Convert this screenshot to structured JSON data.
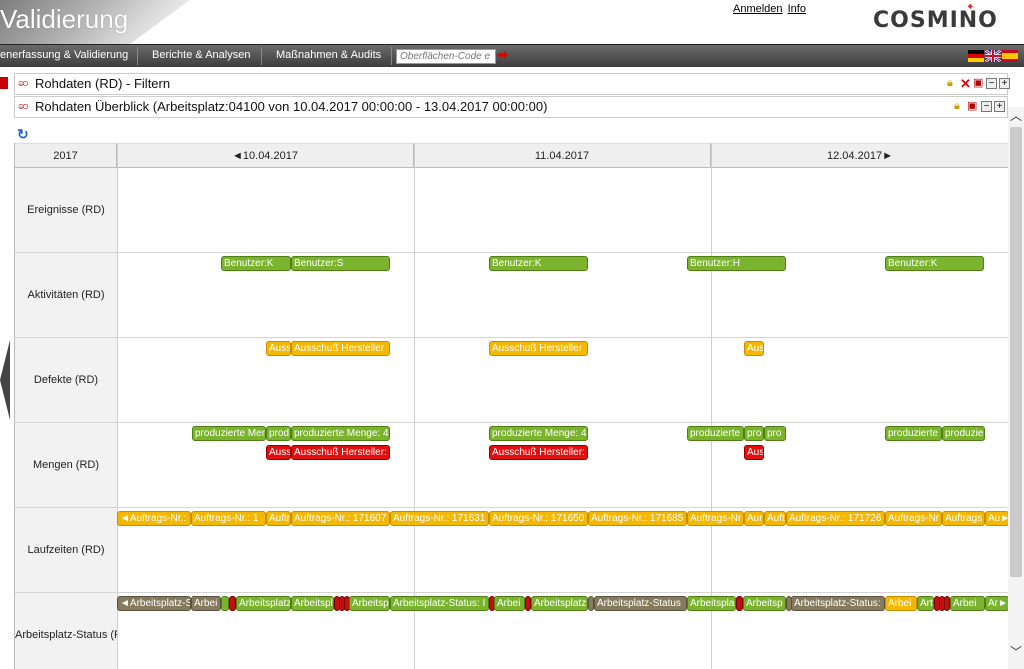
{
  "header": {
    "title": "Validierung",
    "login_link": "Anmelden",
    "info_link": "Info",
    "logo": "COSMINO"
  },
  "nav": {
    "items": [
      "enerfassung & Validierung",
      "Berichte & Analysen",
      "Maßnahmen & Audits"
    ],
    "search_placeholder": "Oberflächen-Code e"
  },
  "panels": {
    "filter_title": "Rohdaten (RD) - Filtern",
    "overview_title": "Rohdaten Überblick (Arbeitsplatz:04100 von 10.04.2017 00:00:00 - 13.04.2017 00:00:00)"
  },
  "timeline": {
    "year": "2017",
    "days": [
      "◄10.04.2017",
      "11.04.2017",
      "12.04.2017►"
    ],
    "rows": [
      "Ereignisse (RD)",
      "Aktivitäten (RD)",
      "Defekte (RD)",
      "Mengen (RD)",
      "Laufzeiten (RD)",
      "Arbeitsplatz-Status (RD)"
    ]
  },
  "bars": {
    "aktivitaeten": [
      "Benutzer:K",
      "Benutzer:S",
      "Benutzer:K",
      "Benutzer:H",
      "Benutzer:K"
    ],
    "defekte": [
      "Auss",
      "Ausschuß Hersteller",
      "Ausschuß Hersteller",
      "Aus"
    ],
    "mengen_green": [
      "produzierte Menge",
      "prod",
      "produzierte Menge: 4",
      "produzierte Menge: 4",
      "produzierte",
      "pro",
      "pro",
      "produzierte",
      "produzie"
    ],
    "mengen_red": [
      "Auss",
      "Ausschuß Hersteller:",
      "Ausschuß Hersteller:",
      "Aus"
    ],
    "laufzeiten": [
      "◄Auftrags-Nr.:",
      "Auftrags-Nr.: 1",
      "Auftr",
      "Auftrags-Nr.: 171607",
      "Auftrags-Nr.: 171631",
      "Auftrags-Nr.: 171650",
      "Auftrags-Nr.: 171685",
      "Auftrags-Nr",
      "Aur",
      "Auft",
      "Auftrags-Nr.: 171726",
      "Auftrags-Nr",
      "Auftrags",
      "Au►"
    ],
    "status": [
      "◄Arbeitsplatz-S",
      "Arbei",
      "Arbeitsplatz",
      "Arbeitspl",
      "Arbeitspl",
      "Arbeitsplatz-Status: I",
      "Arbei",
      "Arbeitsplatz",
      "Arbeitsplatz-Status",
      "Arbeitspla",
      "Arbeitsp",
      "Arbeitsplatz-Status:",
      "Arbei",
      "Art",
      "Arbei",
      "Ar►"
    ]
  },
  "colors": {
    "green": "#7bb32e",
    "orange": "#f5b800",
    "red": "#e01010",
    "brown": "#857a5c",
    "nav": "#4a4a4a"
  }
}
